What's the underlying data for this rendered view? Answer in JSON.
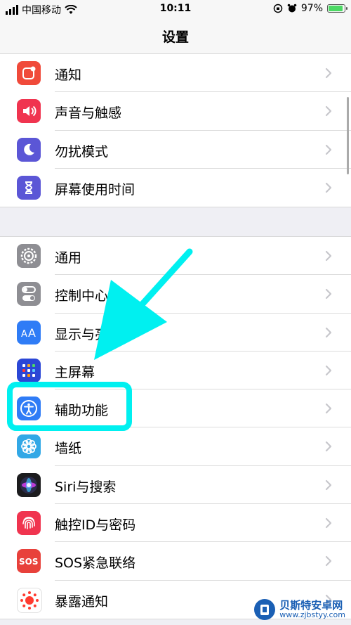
{
  "status_bar": {
    "carrier": "中国移动",
    "time": "10:11",
    "battery_pct": "97%"
  },
  "nav": {
    "title": "设置"
  },
  "group1": [
    {
      "label": "通知",
      "icon": "notifications-icon",
      "color": "#f04a3a"
    },
    {
      "label": "声音与触感",
      "icon": "sound-icon",
      "color": "#f0344f"
    },
    {
      "label": "勿扰模式",
      "icon": "moon-icon",
      "color": "#5b56d6"
    },
    {
      "label": "屏幕使用时间",
      "icon": "hourglass-icon",
      "color": "#5b56d6"
    }
  ],
  "group2": [
    {
      "label": "通用",
      "icon": "gear-icon",
      "color": "#8e8e93"
    },
    {
      "label": "控制中心",
      "icon": "toggle-icon",
      "color": "#8e8e93"
    },
    {
      "label": "显示与亮",
      "icon": "display-icon",
      "color": "#2f7cf6"
    },
    {
      "label": "主屏幕",
      "icon": "home-screen-icon",
      "color": "#2b47d6"
    },
    {
      "label": "辅助功能",
      "icon": "accessibility-icon",
      "color": "#2f7cf6"
    },
    {
      "label": "墙纸",
      "icon": "wallpaper-icon",
      "color": "#32a8e6"
    },
    {
      "label": "Siri与搜索",
      "icon": "siri-icon",
      "color": "#1c1c1e"
    },
    {
      "label": "触控ID与密码",
      "icon": "fingerprint-icon",
      "color": "#f0344f"
    },
    {
      "label": "SOS紧急联络",
      "icon": "sos-icon",
      "color": "#e8413b"
    },
    {
      "label": "暴露通知",
      "icon": "exposure-icon",
      "color": "#ffffff"
    }
  ],
  "watermark": {
    "title": "贝斯特安卓网",
    "url": "www.zjbstyy.com"
  },
  "accent": {
    "annotation": "#00f0f0"
  }
}
